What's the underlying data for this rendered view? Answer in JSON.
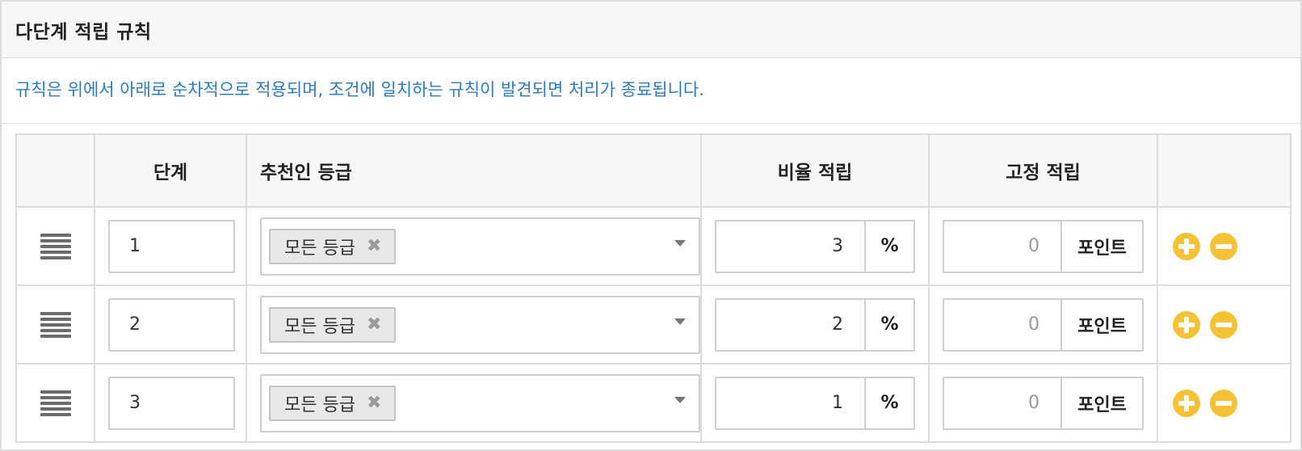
{
  "panel": {
    "title": "다단계 적립 규칙"
  },
  "notice": "규칙은 위에서 아래로 순차적으로 적용되며, 조건에 일치하는 규칙이 발견되면 처리가 종료됩니다.",
  "table": {
    "headers": {
      "drag": "",
      "step": "단계",
      "grade": "추천인 등급",
      "rate": "비율 적립",
      "fixed": "고정 적립",
      "actions": ""
    },
    "rows": [
      {
        "step": "1",
        "grade_tag": "모든 등급",
        "tag_remove": "✖",
        "rate": "3",
        "rate_unit": "%",
        "fixed": "0",
        "fixed_unit": "포인트"
      },
      {
        "step": "2",
        "grade_tag": "모든 등급",
        "tag_remove": "✖",
        "rate": "2",
        "rate_unit": "%",
        "fixed": "0",
        "fixed_unit": "포인트"
      },
      {
        "step": "3",
        "grade_tag": "모든 등급",
        "tag_remove": "✖",
        "rate": "1",
        "rate_unit": "%",
        "fixed": "0",
        "fixed_unit": "포인트"
      }
    ]
  },
  "icons": {
    "drag_handle": "drag-handle-icon",
    "caret": "chevron-down-icon",
    "add": "plus-circle-icon",
    "remove": "minus-circle-icon"
  },
  "colors": {
    "notice_text": "#2b7bc0",
    "action_button": "#f4c234",
    "header_bg": "#f7f7f9",
    "border": "#dcdcdc"
  }
}
